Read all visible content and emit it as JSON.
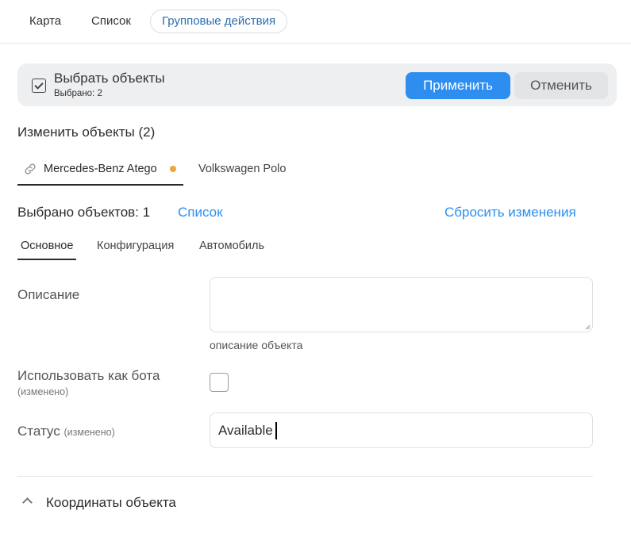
{
  "top_tabs": [
    "Карта",
    "Список",
    "Групповые действия"
  ],
  "select_bar": {
    "title": "Выбрать объекты",
    "subtitle": "Выбрано: 2",
    "apply_label": "Применить",
    "cancel_label": "Отменить"
  },
  "section_title": "Изменить объекты (2)",
  "object_tabs": [
    {
      "label": "Mercedes-Benz Atego",
      "modified": true
    },
    {
      "label": "Volkswagen Polo",
      "modified": false
    }
  ],
  "selection": {
    "count_text": "Выбрано объектов: 1",
    "list_link": "Список",
    "reset_link": "Сбросить изменения"
  },
  "sub_tabs": [
    "Основное",
    "Конфигурация",
    "Автомобиль"
  ],
  "fields": {
    "description": {
      "label": "Описание",
      "value": "",
      "hint": "описание объекта"
    },
    "use_as_bot": {
      "label": "Использовать как бота",
      "note": "(изменено)",
      "checked": false
    },
    "status": {
      "label": "Статус",
      "note": "(изменено)",
      "value": "Available"
    }
  },
  "coords_section": {
    "title": "Координаты объекта",
    "expanded": true
  },
  "colors": {
    "accent": "#2d8ef0",
    "modified_dot": "#f0a433",
    "bar_bg": "#eeeff1"
  }
}
